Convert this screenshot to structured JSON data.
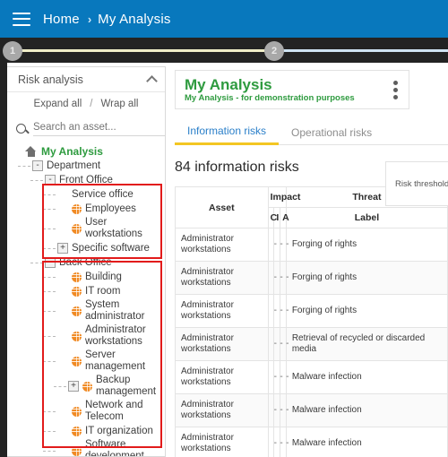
{
  "topbar": {
    "menu_icon": "hamburger-icon",
    "home_label": "Home",
    "separator": "›",
    "current_label": "My Analysis"
  },
  "steps": {
    "step1": "1",
    "step2": "2"
  },
  "sidebar": {
    "header_title": "Risk analysis",
    "collapse_icon": "chevron-up-icon",
    "expand_all": "Expand all",
    "slash": "/",
    "wrap_all": "Wrap all",
    "search_placeholder": "Search an asset...",
    "search_value": "",
    "search_icon": "search-icon",
    "tree": [
      {
        "label": "My Analysis",
        "level": 0,
        "kind": "root",
        "icon": "home-icon",
        "toggle": null
      },
      {
        "label": "Department",
        "level": 0,
        "kind": "branch",
        "icon": null,
        "toggle": "-"
      },
      {
        "label": "Front Office",
        "level": 1,
        "kind": "branch",
        "icon": null,
        "toggle": "-"
      },
      {
        "label": "Service office",
        "level": 2,
        "kind": "leaf",
        "icon": null,
        "toggle": null
      },
      {
        "label": "Employees",
        "level": 2,
        "kind": "leaf",
        "icon": "globe-icon",
        "toggle": null
      },
      {
        "label": "User workstations",
        "level": 2,
        "kind": "leaf",
        "icon": "globe-icon",
        "toggle": null
      },
      {
        "label": "Specific software",
        "level": 2,
        "kind": "branch",
        "icon": null,
        "toggle": "+"
      },
      {
        "label": "Back Office",
        "level": 1,
        "kind": "branch",
        "icon": null,
        "toggle": "-"
      },
      {
        "label": "Building",
        "level": 2,
        "kind": "leaf",
        "icon": "globe-icon",
        "toggle": null
      },
      {
        "label": "IT room",
        "level": 2,
        "kind": "leaf",
        "icon": "globe-icon",
        "toggle": null
      },
      {
        "label": "System administrator",
        "level": 2,
        "kind": "leaf",
        "icon": "globe-icon",
        "toggle": null
      },
      {
        "label": "Administrator workstations",
        "level": 2,
        "kind": "leaf",
        "icon": "globe-icon",
        "toggle": null
      },
      {
        "label": "Server management",
        "level": 2,
        "kind": "leaf",
        "icon": "globe-icon",
        "toggle": null
      },
      {
        "label": "Backup management",
        "level": 3,
        "kind": "branch",
        "icon": "globe-icon",
        "toggle": "+"
      },
      {
        "label": "Network and Telecom",
        "level": 2,
        "kind": "leaf",
        "icon": "globe-icon",
        "toggle": null
      },
      {
        "label": "IT organization",
        "level": 2,
        "kind": "leaf",
        "icon": "globe-icon",
        "toggle": null
      },
      {
        "label": "Software development",
        "level": 2,
        "kind": "leaf",
        "icon": "globe-icon",
        "toggle": null
      }
    ]
  },
  "annotations": {
    "highlight_color": "#e21b1b",
    "boxes": [
      "front-office-group",
      "back-office-group"
    ]
  },
  "main": {
    "card": {
      "title": "My Analysis",
      "subtitle": "My Analysis - for demonstration purposes",
      "menu_icon": "kebab-menu-icon"
    },
    "tabs": [
      {
        "label": "Information risks",
        "active": true
      },
      {
        "label": "Operational risks",
        "active": false
      }
    ],
    "count_title": "84 information risks",
    "threshold_card_label": "Risk threshold",
    "table": {
      "group_headers": [
        {
          "label": "Asset",
          "span": 1,
          "rowspan": 2
        },
        {
          "label": "Impact",
          "span": 3,
          "rowspan": 1
        },
        {
          "label": "Threat",
          "span": 1,
          "rowspan": 1
        }
      ],
      "sub_headers": [
        "C",
        "I",
        "A",
        "Label"
      ],
      "rows": [
        {
          "asset": "Administrator workstations",
          "c": "-",
          "i": "-",
          "a": "-",
          "label": "Forging of rights"
        },
        {
          "asset": "Administrator workstations",
          "c": "-",
          "i": "-",
          "a": "-",
          "label": "Forging of rights"
        },
        {
          "asset": "Administrator workstations",
          "c": "-",
          "i": "-",
          "a": "-",
          "label": "Forging of rights"
        },
        {
          "asset": "Administrator workstations",
          "c": "-",
          "i": "-",
          "a": "-",
          "label": "Retrieval of recycled or discarded media"
        },
        {
          "asset": "Administrator workstations",
          "c": "-",
          "i": "-",
          "a": "-",
          "label": "Malware infection"
        },
        {
          "asset": "Administrator workstations",
          "c": "-",
          "i": "-",
          "a": "-",
          "label": "Malware infection"
        },
        {
          "asset": "Administrator workstations",
          "c": "-",
          "i": "-",
          "a": "-",
          "label": "Malware infection"
        }
      ]
    }
  },
  "colors": {
    "brand_blue": "#0878bd",
    "tab_active": "#2a7fc9",
    "tab_underline": "#f3c623",
    "green_title": "#2e9b3f",
    "node_orange": "#f08a24",
    "dark_strip": "#232323"
  }
}
